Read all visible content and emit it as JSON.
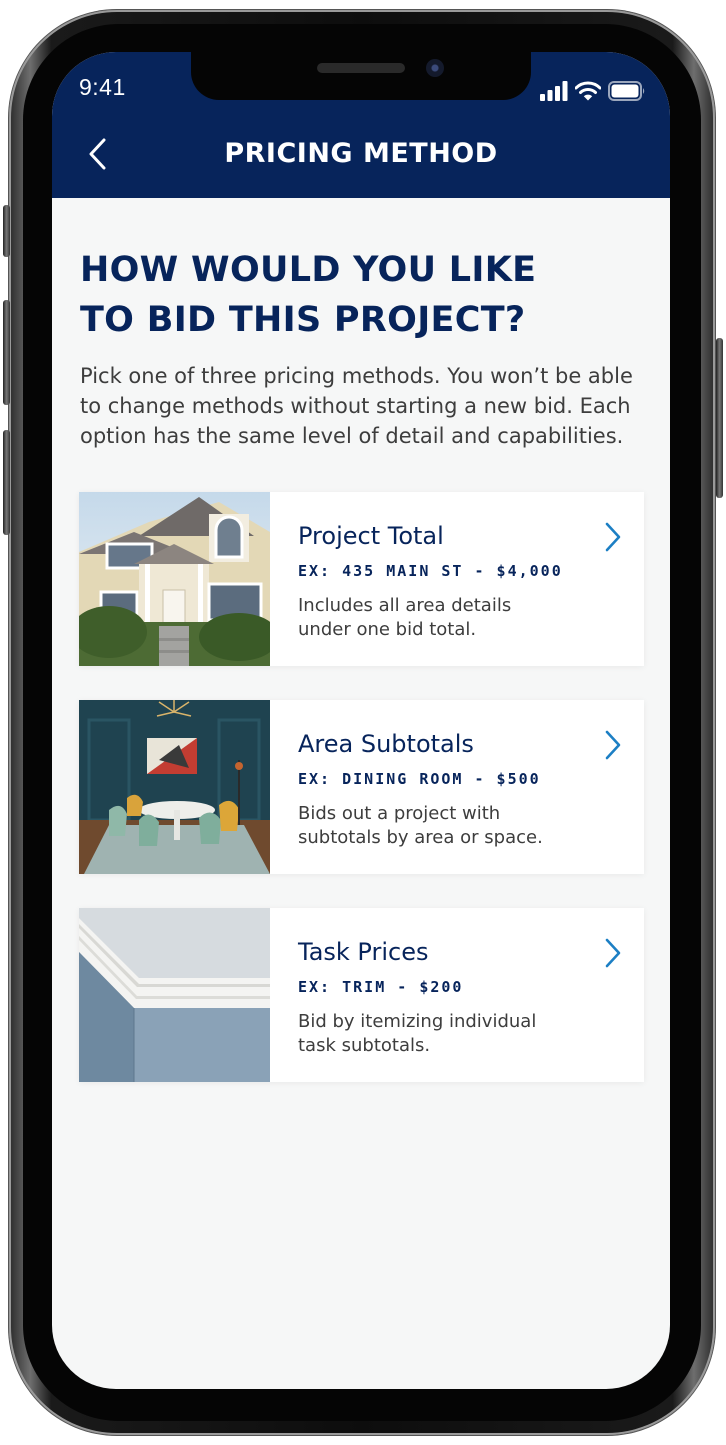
{
  "status_bar": {
    "time": "9:41"
  },
  "nav": {
    "title": "PRICING METHOD"
  },
  "main": {
    "heading_line1": "HOW WOULD YOU LIKE",
    "heading_line2": "TO BID THIS PROJECT?",
    "intro": "Pick one of three pricing methods. You won’t be able to change methods without starting a new bid. Each option has the same level of detail and capabilities."
  },
  "options": [
    {
      "title": "Project Total",
      "example": "EX: 435 MAIN ST - $4,000",
      "description_line1": "Includes all area details",
      "description_line2": "under one bid total."
    },
    {
      "title": "Area Subtotals",
      "example": "EX: DINING ROOM - $500",
      "description_line1": "Bids out a project with",
      "description_line2": "subtotals by area or space."
    },
    {
      "title": "Task Prices",
      "example": "EX: TRIM - $200",
      "description_line1": "Bid by itemizing individual",
      "description_line2": "task subtotals."
    }
  ],
  "colors": {
    "nav_background": "#07245b",
    "title_text": "#07245b",
    "chevron": "#1c7fc4",
    "body_background": "#f6f7f7"
  },
  "icons": {
    "back": "chevron-left-icon",
    "option_arrow": "chevron-right-icon",
    "signal": "signal-icon",
    "wifi": "wifi-icon",
    "battery": "battery-icon"
  }
}
